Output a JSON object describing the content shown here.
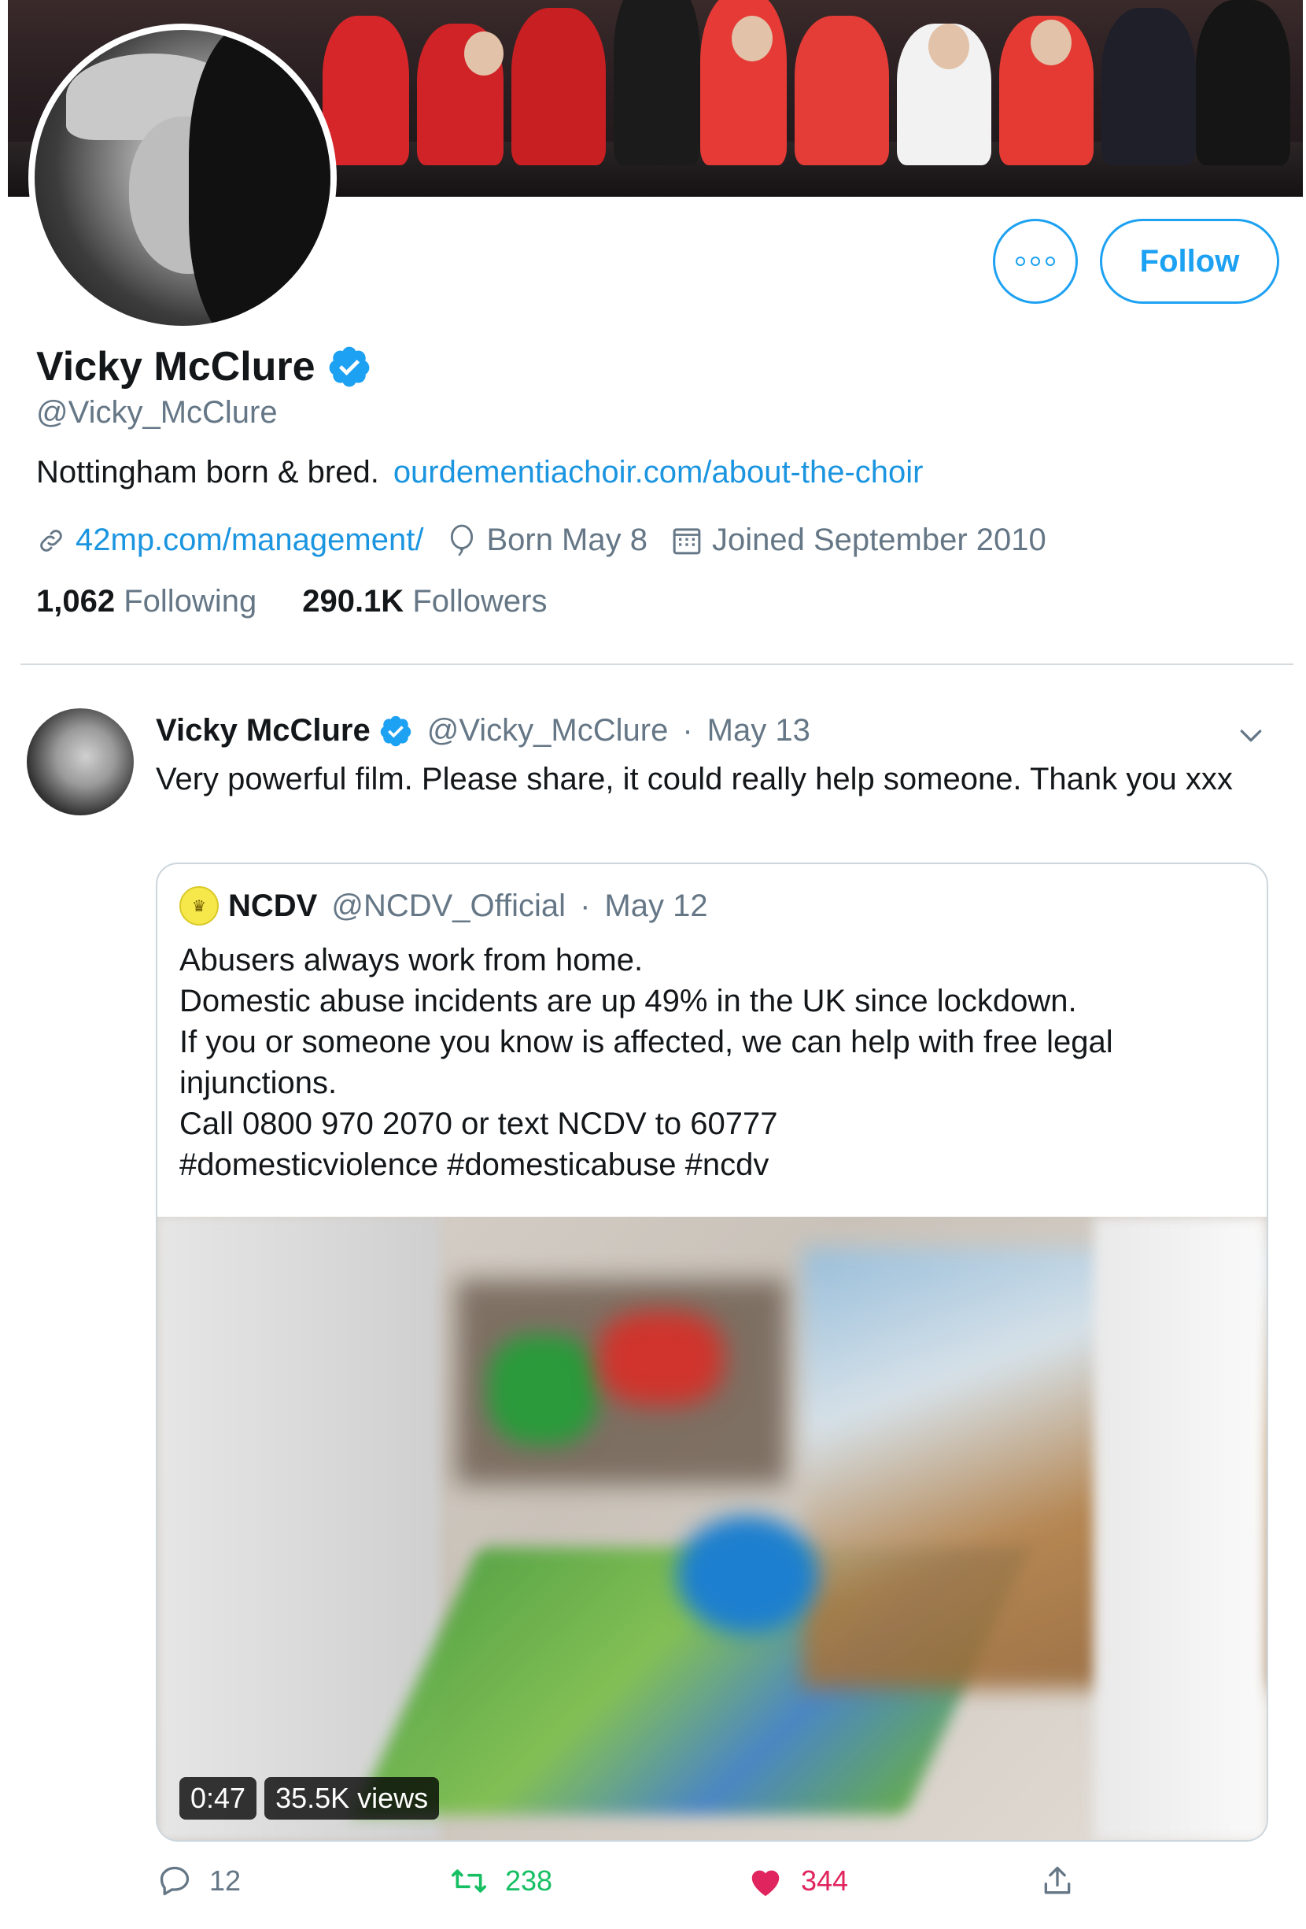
{
  "profile": {
    "display_name": "Vicky McClure",
    "handle": "@Vicky_McClure",
    "bio_text": "Nottingham born & bred.",
    "bio_link": "ourdementiachoir.com/about-the-choir",
    "website": "42mp.com/management/",
    "birthday": "Born May 8",
    "joined": "Joined September 2010",
    "following_count": "1,062",
    "following_label": "Following",
    "followers_count": "290.1K",
    "followers_label": "Followers",
    "follow_button": "Follow"
  },
  "tweet": {
    "author_name": "Vicky McClure",
    "author_handle": "@Vicky_McClure",
    "separator": "·",
    "date": "May 13",
    "text": "Very powerful film. Please share, it could really help someone. Thank you xxx",
    "quoted": {
      "author_name": "NCDV",
      "author_handle": "@NCDV_Official",
      "date": "May 12",
      "lines": [
        "Abusers always work from home.",
        "Domestic abuse incidents are up 49% in the UK since lockdown.",
        "If you or someone you know is affected, we can help with free legal",
        "injunctions.",
        "Call 0800 970 2070 or text NCDV to 60777",
        "#domesticviolence #domesticabuse #ncdv"
      ],
      "video_duration": "0:47",
      "video_views": "35.5K views"
    },
    "reply_count": "12",
    "retweet_count": "238",
    "like_count": "344"
  },
  "colors": {
    "accent": "#1da1f2",
    "link": "#1b95e0",
    "secondary_text": "#657786",
    "retweet_green": "#17bf63",
    "like_red": "#e0245e"
  },
  "icons": [
    "more-icon",
    "verified-badge-icon",
    "link-icon",
    "balloon-icon",
    "calendar-icon",
    "chevron-down-icon",
    "reply-icon",
    "retweet-icon",
    "heart-icon",
    "share-icon"
  ]
}
